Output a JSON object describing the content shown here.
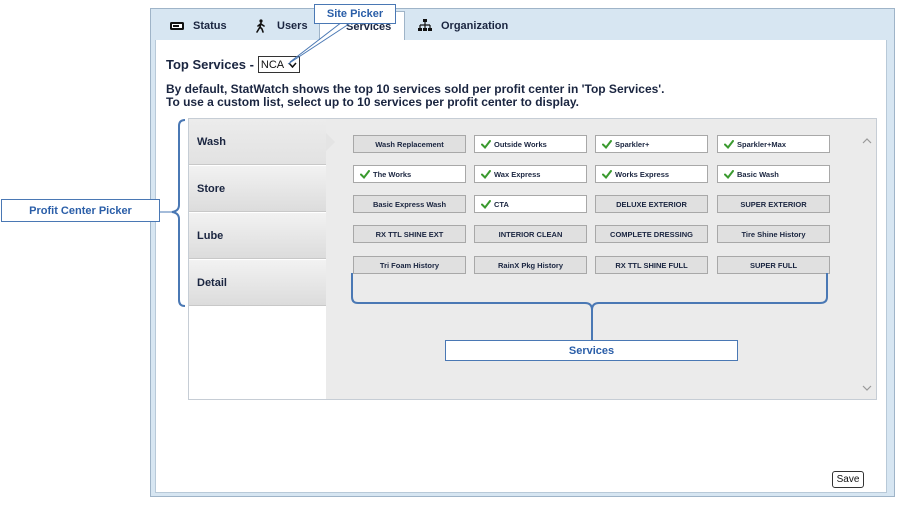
{
  "tabs": [
    {
      "label": "Status",
      "icon": "status-icon"
    },
    {
      "label": "Users",
      "icon": "walking-person-icon"
    },
    {
      "label": "Services",
      "icon": "none"
    },
    {
      "label": "Organization",
      "icon": "org-chart-icon"
    }
  ],
  "header": {
    "title": "Top Services -",
    "site_value": "NCA"
  },
  "description": {
    "line1": "By default, StatWatch shows the top 10 services sold per profit center in 'Top Services'.",
    "line2": "To use a custom list, select up to 10 services per profit center to display."
  },
  "profit_centers": [
    "Wash",
    "Store",
    "Lube",
    "Detail"
  ],
  "selected_profit_center": "Wash",
  "services": [
    {
      "label": "Wash Replacement",
      "selected": false
    },
    {
      "label": "Outside Works",
      "selected": true
    },
    {
      "label": "Sparkler+",
      "selected": true
    },
    {
      "label": "Sparkler+Max",
      "selected": true
    },
    {
      "label": "The Works",
      "selected": true
    },
    {
      "label": "Wax Express",
      "selected": true
    },
    {
      "label": "Works Express",
      "selected": true
    },
    {
      "label": "Basic Wash",
      "selected": true
    },
    {
      "label": "Basic Express Wash",
      "selected": false
    },
    {
      "label": "CTA",
      "selected": true
    },
    {
      "label": "DELUXE EXTERIOR",
      "selected": false
    },
    {
      "label": "SUPER EXTERIOR",
      "selected": false
    },
    {
      "label": "RX TTL SHINE EXT",
      "selected": false
    },
    {
      "label": "INTERIOR CLEAN",
      "selected": false
    },
    {
      "label": "COMPLETE DRESSING",
      "selected": false
    },
    {
      "label": "Tire Shine History",
      "selected": false
    },
    {
      "label": "Tri Foam History",
      "selected": false
    },
    {
      "label": "RainX Pkg History",
      "selected": false
    },
    {
      "label": "RX TTL SHINE FULL",
      "selected": false
    },
    {
      "label": "SUPER FULL",
      "selected": false
    }
  ],
  "buttons": {
    "save": "Save"
  },
  "callouts": {
    "site_picker": "Site Picker",
    "profit_center_picker": "Profit Center Picker",
    "services": "Services"
  },
  "colors": {
    "accent": "#2a5ea8",
    "check": "#3a9a2e",
    "frame": "#d7e6f2"
  }
}
